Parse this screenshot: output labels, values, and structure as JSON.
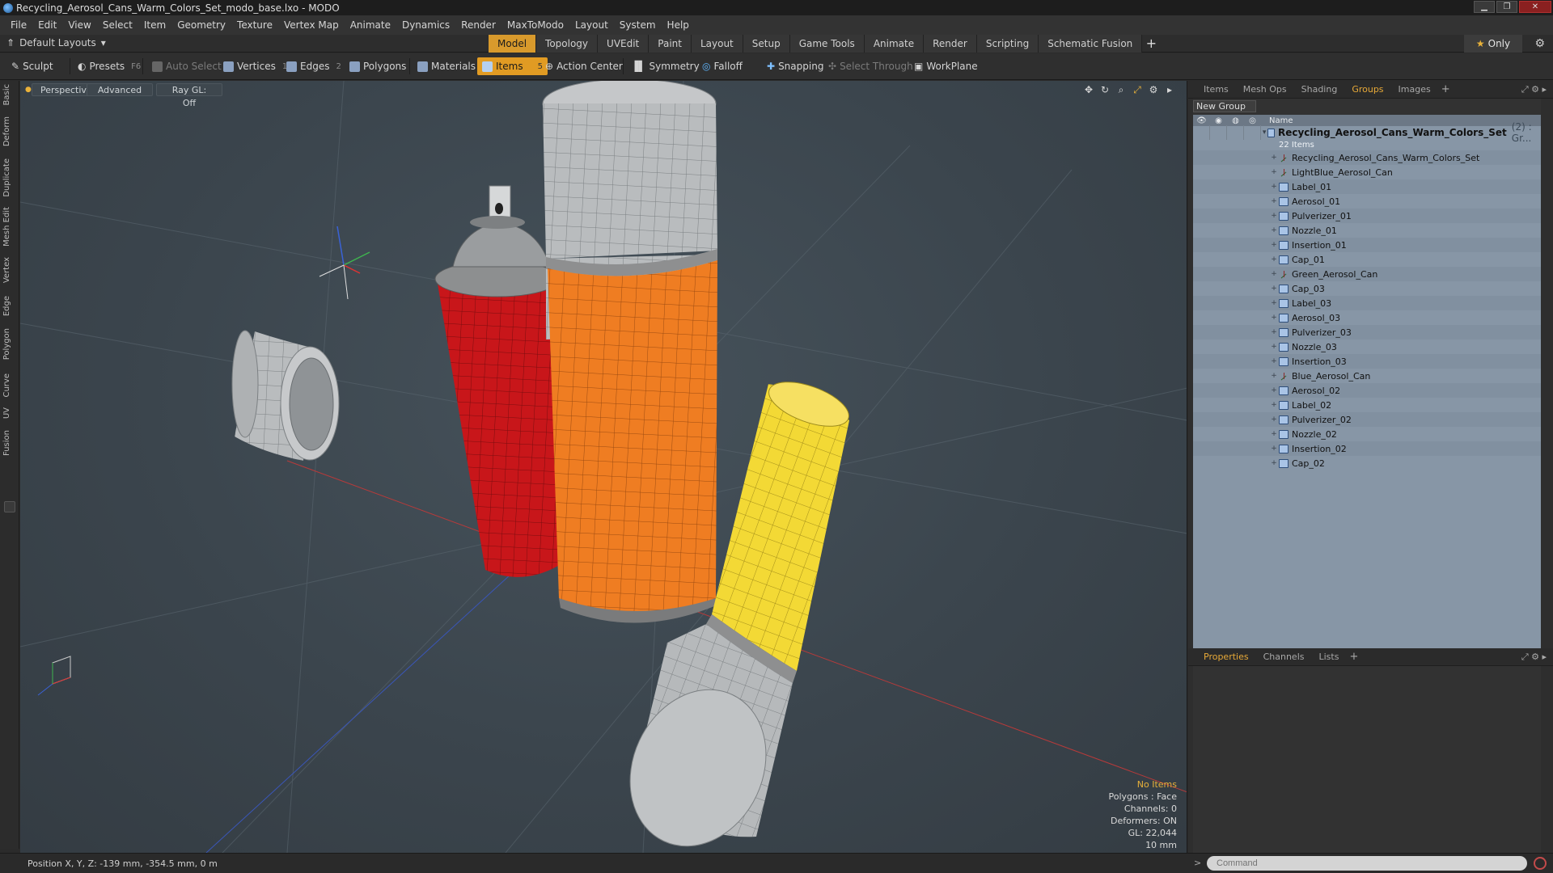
{
  "window": {
    "title": "Recycling_Aerosol_Cans_Warm_Colors_Set_modo_base.lxo - MODO"
  },
  "menu": [
    "File",
    "Edit",
    "View",
    "Select",
    "Item",
    "Geometry",
    "Texture",
    "Vertex Map",
    "Animate",
    "Dynamics",
    "Render",
    "MaxToModo",
    "Layout",
    "System",
    "Help"
  ],
  "layoutbar": {
    "layouts_label": "Default Layouts",
    "tabs": [
      "Model",
      "Topology",
      "UVEdit",
      "Paint",
      "Layout",
      "Setup",
      "Game Tools",
      "Animate",
      "Render",
      "Scripting",
      "Schematic Fusion"
    ],
    "active_tab": "Model",
    "only_label": "Only"
  },
  "toolbar": {
    "sculpt": "Sculpt",
    "presets": "Presets",
    "presets_key": "F6",
    "auto_select": "Auto Select",
    "vertices": "Vertices",
    "vertices_key": "1",
    "edges": "Edges",
    "edges_key": "2",
    "polygons": "Polygons",
    "materials": "Materials",
    "items": "Items",
    "items_key": "5",
    "action_center": "Action Center",
    "symmetry": "Symmetry",
    "falloff": "Falloff",
    "snapping": "Snapping",
    "select_through": "Select Through",
    "workplane": "WorkPlane"
  },
  "left_tabs": [
    "Basic",
    "Deform",
    "Duplicate",
    "Mesh Edit",
    "Vertex",
    "Edge",
    "Polygon",
    "Curve",
    "UV",
    "Fusion"
  ],
  "viewport": {
    "perspective": "Perspective",
    "advanced": "Advanced",
    "raygl": "Ray GL: Off",
    "info": {
      "selection": "No Items",
      "polygons": "Polygons : Face",
      "channels": "Channels: 0",
      "deformers": "Deformers: ON",
      "gl": "GL: 22,044",
      "scale": "10 mm"
    },
    "colors": {
      "red": "#c8161a",
      "orange": "#ef7d22",
      "yellow": "#f3d935",
      "cap_grey": "#b9bcbe",
      "band_grey": "#8e8f90"
    }
  },
  "right_panel": {
    "tabs": [
      "Items",
      "Mesh Ops",
      "Shading",
      "Groups",
      "Images"
    ],
    "active_tab": "Groups",
    "new_group": "New Group",
    "name_header": "Name",
    "group": {
      "name": "Recycling_Aerosol_Cans_Warm_Colors_Set",
      "count": "(2) : Gr...",
      "items_label": "22 Items",
      "children": [
        {
          "name": "Recycling_Aerosol_Cans_Warm_Colors_Set",
          "type": "locator"
        },
        {
          "name": "LightBlue_Aerosol_Can",
          "type": "locator"
        },
        {
          "name": "Label_01",
          "type": "mesh"
        },
        {
          "name": "Aerosol_01",
          "type": "mesh"
        },
        {
          "name": "Pulverizer_01",
          "type": "mesh"
        },
        {
          "name": "Nozzle_01",
          "type": "mesh"
        },
        {
          "name": "Insertion_01",
          "type": "mesh"
        },
        {
          "name": "Cap_01",
          "type": "mesh"
        },
        {
          "name": "Green_Aerosol_Can",
          "type": "locator"
        },
        {
          "name": "Cap_03",
          "type": "mesh"
        },
        {
          "name": "Label_03",
          "type": "mesh"
        },
        {
          "name": "Aerosol_03",
          "type": "mesh"
        },
        {
          "name": "Pulverizer_03",
          "type": "mesh"
        },
        {
          "name": "Nozzle_03",
          "type": "mesh"
        },
        {
          "name": "Insertion_03",
          "type": "mesh"
        },
        {
          "name": "Blue_Aerosol_Can",
          "type": "locator"
        },
        {
          "name": "Aerosol_02",
          "type": "mesh"
        },
        {
          "name": "Label_02",
          "type": "mesh"
        },
        {
          "name": "Pulverizer_02",
          "type": "mesh"
        },
        {
          "name": "Nozzle_02",
          "type": "mesh"
        },
        {
          "name": "Insertion_02",
          "type": "mesh"
        },
        {
          "name": "Cap_02",
          "type": "mesh"
        }
      ]
    },
    "props_tabs": [
      "Properties",
      "Channels",
      "Lists"
    ],
    "props_active": "Properties"
  },
  "status": {
    "position": "Position X, Y, Z:  -139 mm, -354.5 mm, 0 m",
    "command_placeholder": "Command"
  }
}
